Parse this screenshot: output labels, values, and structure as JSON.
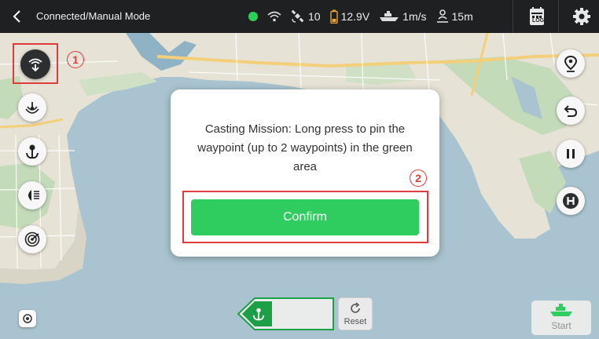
{
  "topbar": {
    "title": "Connected/Manual Mode",
    "satellites": "10",
    "voltage": "12.9V",
    "speed": "1m/s",
    "distance": "15m",
    "log_label": "LOG",
    "connection_color": "#2bd157"
  },
  "dialog": {
    "message": "Casting Mission: Long press to pin the waypoint (up to 2 waypoints) in the green area",
    "confirm_label": "Confirm"
  },
  "annotations": {
    "marker_1": "1",
    "marker_2": "2"
  },
  "waypoints": {
    "top": "2",
    "bottom": "1"
  },
  "bottom": {
    "reset_label": "Reset",
    "start_label": "Start"
  },
  "left_tools": [
    "casting-mission-icon",
    "sonar-icon",
    "anchor-icon",
    "headlight-icon",
    "radar-icon"
  ],
  "right_tools": [
    "location-pin-icon",
    "return-icon",
    "pause-icon",
    "home-icon"
  ],
  "colors": {
    "accent_green": "#2fcd5f",
    "waypoint_green": "#1da045",
    "annotation_red": "#e23b3b",
    "water": "#a9c4d0",
    "land": "#e6e2d6",
    "park": "#c4dbba"
  }
}
